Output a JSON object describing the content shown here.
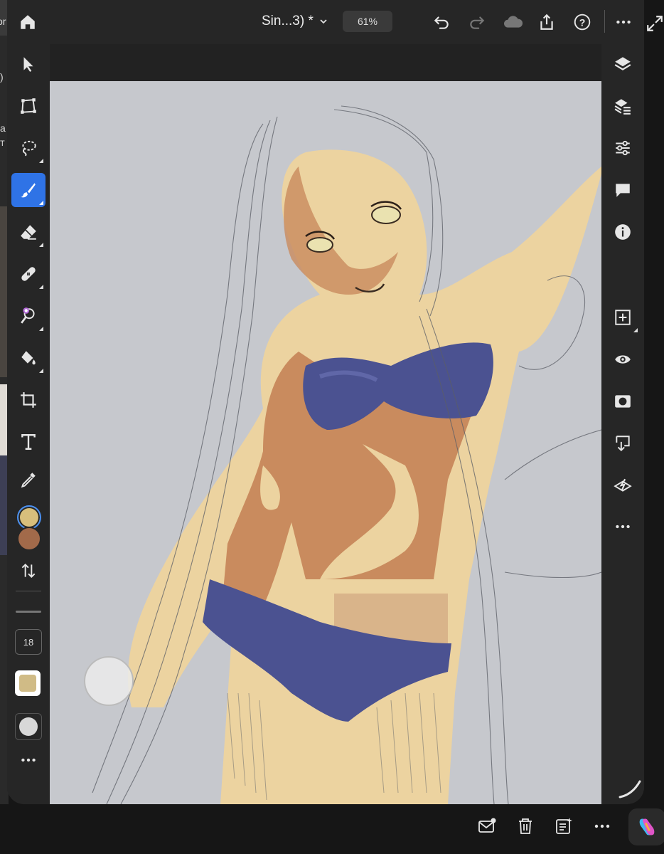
{
  "behind_window": {
    "text_fragments": [
      ")",
      "a",
      "T"
    ]
  },
  "topbar": {
    "document_title": "Sin...3) *",
    "zoom_level": "61%",
    "icons": [
      "home-icon",
      "undo-icon",
      "redo-icon",
      "cloud-icon",
      "share-icon",
      "help-icon",
      "more-icon",
      "expand-icon"
    ]
  },
  "left_toolbar": {
    "tools": [
      "select",
      "transform",
      "lasso",
      "brush",
      "eraser",
      "healing",
      "smart-select",
      "fill",
      "crop",
      "type",
      "eyedropper"
    ],
    "active_tool": "brush",
    "foreground_color": "#d8bf7c",
    "background_color": "#a26a4a",
    "brush_size": "18"
  },
  "right_toolbar": {
    "icons": [
      "layers-icon",
      "layer-properties-icon",
      "adjustments-icon",
      "comments-icon",
      "info-icon",
      "add-layer-icon",
      "visibility-icon",
      "mask-icon",
      "merge-down-icon",
      "clear-layer-icon",
      "more-icon"
    ]
  },
  "canvas": {
    "background": "#c6c8cd"
  },
  "bottombar": {
    "icons": [
      "mail-icon",
      "trash-icon",
      "notes-icon",
      "more-icon",
      "copilot-icon"
    ]
  }
}
